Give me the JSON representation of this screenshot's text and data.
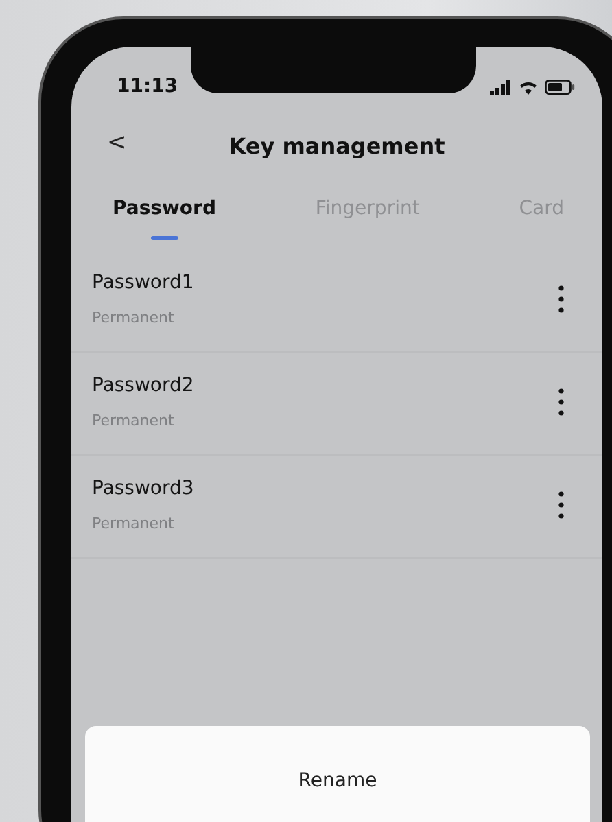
{
  "status_bar": {
    "time": "11:13"
  },
  "header": {
    "back": "<",
    "title": "Key management"
  },
  "tabs": [
    {
      "label": "Password",
      "selected": true
    },
    {
      "label": "Fingerprint",
      "selected": false
    },
    {
      "label": "Card",
      "selected": false
    }
  ],
  "keys": [
    {
      "name": "Password1",
      "validity": "Permanent"
    },
    {
      "name": "Password2",
      "validity": "Permanent"
    },
    {
      "name": "Password3",
      "validity": "Permanent"
    }
  ],
  "action_sheet": {
    "options": [
      "Rename"
    ]
  }
}
